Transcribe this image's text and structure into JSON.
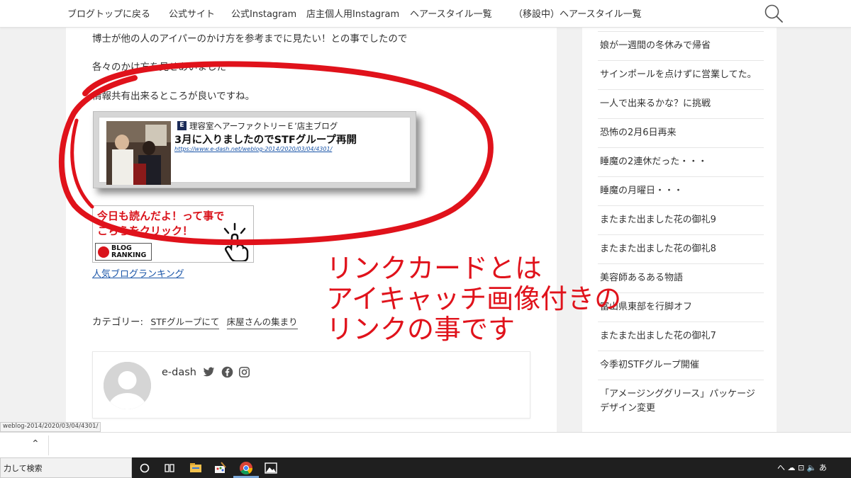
{
  "nav": {
    "items": [
      "ブログトップに戻る",
      "公式サイト",
      "公式Instagram",
      "店主個人用Instagram",
      "ヘアースタイル一覧",
      "（移設中）ヘアースタイル一覧"
    ],
    "search_icon": "search-icon"
  },
  "article": {
    "para1": "博士が他の人のアイパーのかけ方を参考までに見たい！との事でしたので",
    "para2": "各々のかけ方を見せあいました",
    "para3": "情報共有出来るところが良いですね。",
    "link_card": {
      "site_icon_letter": "E",
      "site_name": "理容室ヘアーファクトリーＥ’店主ブログ",
      "title": "3月に入りましたのでSTFグループ再開",
      "url": "https://www.e-dash.net/weblog-2014/2020/03/04/4301/"
    },
    "ranking_banner": {
      "line1": "今日も読んだよ！って事で",
      "line2": "こちらをクリック！",
      "logo_line1": "BLOG",
      "logo_line2": "RANKING"
    },
    "ranking_link": "人気ブログランキング",
    "category_label": "カテゴリー:",
    "categories": [
      "STFグループにて",
      "床屋さんの集まり"
    ],
    "author": {
      "name": "e-dash",
      "social_icons": [
        "twitter-icon",
        "facebook-icon",
        "instagram-icon"
      ]
    }
  },
  "sidebar": {
    "items": [
      "娘が一週間の冬休みで帰省",
      "サインポールを点けずに営業してた。",
      "一人で出来るかな？に挑戦",
      "恐怖の2月6日再来",
      "睡魔の2連休だった・・・",
      "睡魔の月曜日・・・",
      "またまた出ました花の御礼9",
      "またまた出ました花の御礼8",
      "美容師あるある物語",
      "富山県東部を行脚オフ",
      "またまた出ました花の御礼7",
      "今季初STFグループ開催",
      "「アメージンググリース」パッケージデザイン変更"
    ]
  },
  "annotation": {
    "line1": "リンクカードとは",
    "line2": "アイキャッチ画像付きの",
    "line3": "リンクの事です",
    "color": "#e0121b"
  },
  "status_bar": {
    "url": "weblog-2014/2020/03/04/4301/"
  },
  "taskbar": {
    "search_text": "力して検索",
    "tray_text": "へ ☁ ⊡ 🔈 あ"
  }
}
